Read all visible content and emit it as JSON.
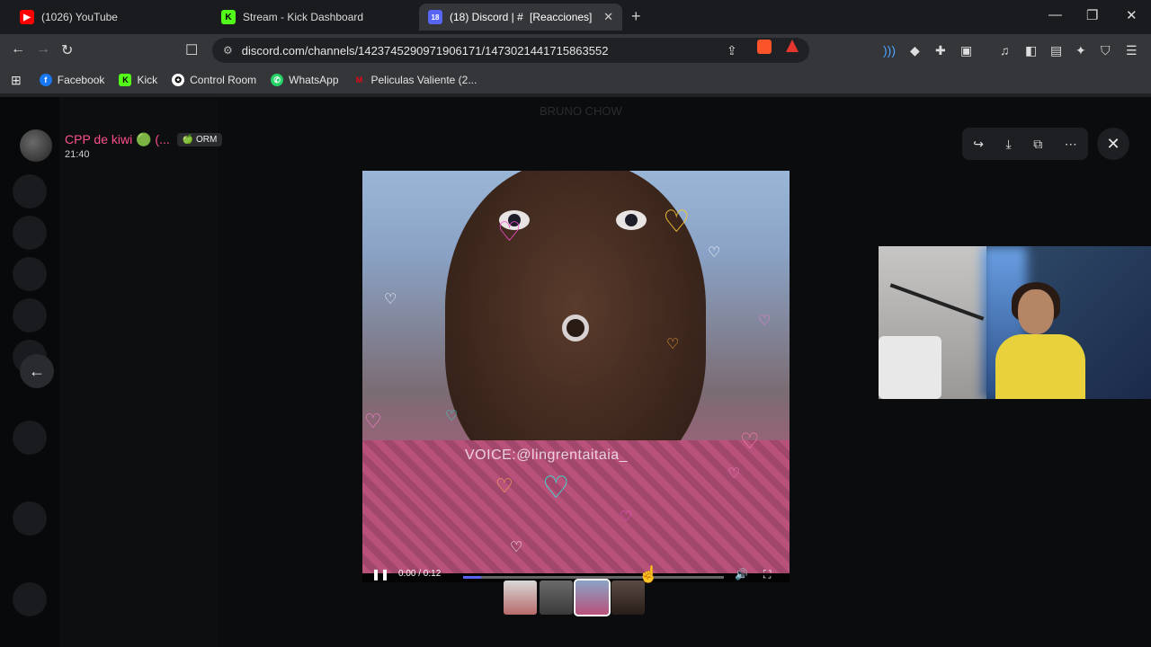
{
  "browser": {
    "tabs": [
      {
        "label": "(1026) YouTube",
        "color": "#ff0000",
        "glyph": "▶"
      },
      {
        "label": "Stream - Kick Dashboard",
        "color": "#53fc18",
        "glyph": "K"
      },
      {
        "label": "(18) Discord | #   [Reacciones]",
        "color": "#5865f2",
        "glyph": "18"
      }
    ],
    "new_tab": "+",
    "url": "discord.com/channels/1423745290971906171/1473021441715863552",
    "bookmarks": [
      {
        "label": "Facebook",
        "color": "#1877f2",
        "glyph": "f"
      },
      {
        "label": "Kick",
        "color": "#53fc18",
        "glyph": "K"
      },
      {
        "label": "Control Room",
        "color": "#ffffff",
        "glyph": "✪"
      },
      {
        "label": "WhatsApp",
        "color": "#25d366",
        "glyph": "✆"
      },
      {
        "label": "Peliculas Valiente (2...",
        "color": "#e50914",
        "glyph": "M"
      }
    ]
  },
  "discord": {
    "background_header": "BRUNO CHOW",
    "author_name": "CPP de kiwi 🟢 (...",
    "author_badge": "🍏 ORM",
    "timestamp": "21:40",
    "video_watermark": "VOICE:@lingrentaitaia_",
    "video_time": "0:00 / 0:12",
    "video_progress": 0.07
  }
}
